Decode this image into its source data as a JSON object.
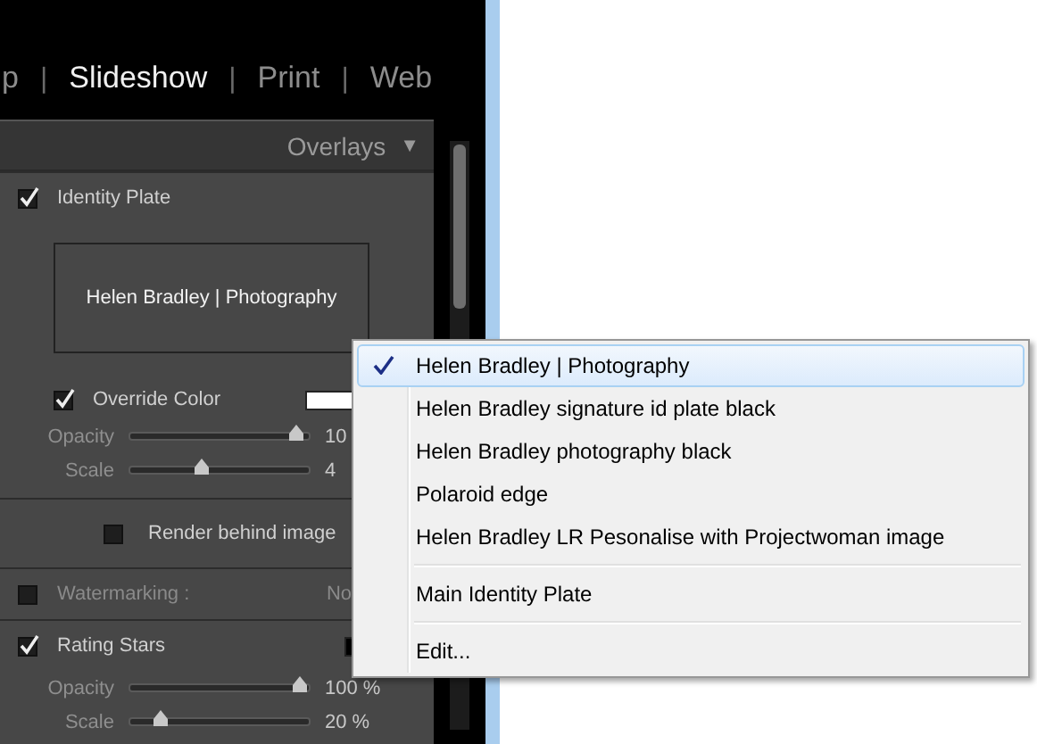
{
  "modules": [
    {
      "label": "p",
      "selected": false
    },
    {
      "label": "Slideshow",
      "selected": true
    },
    {
      "label": "Print",
      "selected": false
    },
    {
      "label": "Web",
      "selected": false
    }
  ],
  "separators": [
    "|",
    "|",
    "|"
  ],
  "panel": {
    "title": "Overlays",
    "toggle": "▼",
    "rows": [
      {
        "kind": "section",
        "label": "Identity Plate",
        "checked": true,
        "disabled": false
      },
      {
        "kind": "plate",
        "text": "Helen Bradley | Photography"
      },
      {
        "kind": "color",
        "label": "Override Color",
        "checked": true,
        "color": "#ffffff"
      },
      {
        "kind": "slider",
        "label": "Opacity",
        "level": 0.93,
        "reading": "10"
      },
      {
        "kind": "slider",
        "label": "Scale",
        "level": 0.4,
        "reading": "4"
      },
      {
        "kind": "option",
        "label": "Render behind image",
        "checked": false
      },
      {
        "kind": "section",
        "label": "Watermarking :",
        "checked": false,
        "disabled": true,
        "value": "No"
      },
      {
        "kind": "section",
        "label": "Rating Stars",
        "checked": true,
        "disabled": false,
        "color": "#000000"
      },
      {
        "kind": "slider",
        "label": "Opacity",
        "level": 0.95,
        "reading": "100 %"
      },
      {
        "kind": "slider",
        "label": "Scale",
        "level": 0.17,
        "reading": "20 %"
      }
    ]
  },
  "menu": {
    "groups": [
      [
        {
          "label": "Helen Bradley | Photography",
          "checked": true,
          "selected": true
        },
        {
          "label": "Helen Bradley signature id plate black",
          "checked": false,
          "selected": false
        },
        {
          "label": "Helen Bradley photography black",
          "checked": false,
          "selected": false
        },
        {
          "label": "Polaroid edge",
          "checked": false,
          "selected": false
        },
        {
          "label": "Helen Bradley LR Pesonalise with Projectwoman image",
          "checked": false,
          "selected": false
        }
      ],
      [
        {
          "label": "Main Identity Plate",
          "checked": false,
          "selected": false
        }
      ],
      [
        {
          "label": "Edit...",
          "checked": false,
          "selected": false
        }
      ]
    ]
  }
}
